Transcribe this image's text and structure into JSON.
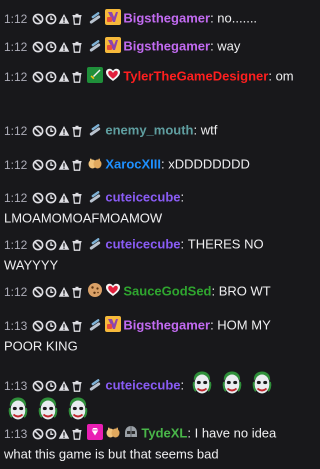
{
  "colors": {
    "background": "#18181b",
    "text": "#efeff1",
    "timestamp": "#adadb8"
  },
  "mod_icons": [
    "ban-icon",
    "timeout-icon",
    "warning-icon",
    "delete-icon"
  ],
  "messages": [
    {
      "time": "1:12",
      "badges": [
        "slash-badge-icon",
        "gamer-badge-icon"
      ],
      "user": "Bigsthegamer",
      "color": "#c26bf1",
      "text": "no......."
    },
    {
      "time": "1:12",
      "badges": [
        "slash-badge-icon",
        "gamer-badge-icon"
      ],
      "user": "Bigsthegamer",
      "color": "#c26bf1",
      "text": "way"
    },
    {
      "time": "1:12",
      "badges": [
        "sword-badge-icon",
        "heart-badge-icon"
      ],
      "user": "TylerTheGameDesigner",
      "color": "#ff1f1f",
      "text": "om"
    },
    {
      "time": "1:12",
      "badges": [
        "slash-badge-icon"
      ],
      "user": "enemy_mouth",
      "color": "#5f9ea0",
      "text": "wtf"
    },
    {
      "time": "1:12",
      "badges": [
        "hands-badge-icon"
      ],
      "user": "XarocXIII",
      "color": "#1e90ff",
      "text": "xDDDDDDDD"
    },
    {
      "time": "1:12",
      "badges": [
        "slash-badge-icon"
      ],
      "user": "cuteicecube",
      "color": "#8a5cf6",
      "text": "LMOAMOMOAFMOAMOW"
    },
    {
      "time": "1:12",
      "badges": [
        "slash-badge-icon"
      ],
      "user": "cuteicecube",
      "color": "#8a5cf6",
      "text": "THERES NO WAYYYY"
    },
    {
      "time": "1:12",
      "badges": [
        "cookie-badge-icon",
        "heart-badge-icon"
      ],
      "user": "SauceGodSed",
      "color": "#2fa52f",
      "text": "BRO WT"
    },
    {
      "time": "1:13",
      "badges": [
        "slash-badge-icon",
        "gamer-badge-icon"
      ],
      "user": "Bigsthegamer",
      "color": "#c26bf1",
      "text": "HOM MY POOR KING"
    },
    {
      "time": "1:13",
      "badges": [
        "slash-badge-icon"
      ],
      "user": "cuteicecube",
      "color": "#8a5cf6",
      "text": "",
      "emotes": 6
    },
    {
      "time": "1:13",
      "badges": [
        "diamond-badge-icon",
        "hands-badge-icon",
        "helmet-badge-icon"
      ],
      "user": "TydeXL",
      "color": "#49b649",
      "text": "I have no idea what this game is but that seems bad"
    }
  ]
}
